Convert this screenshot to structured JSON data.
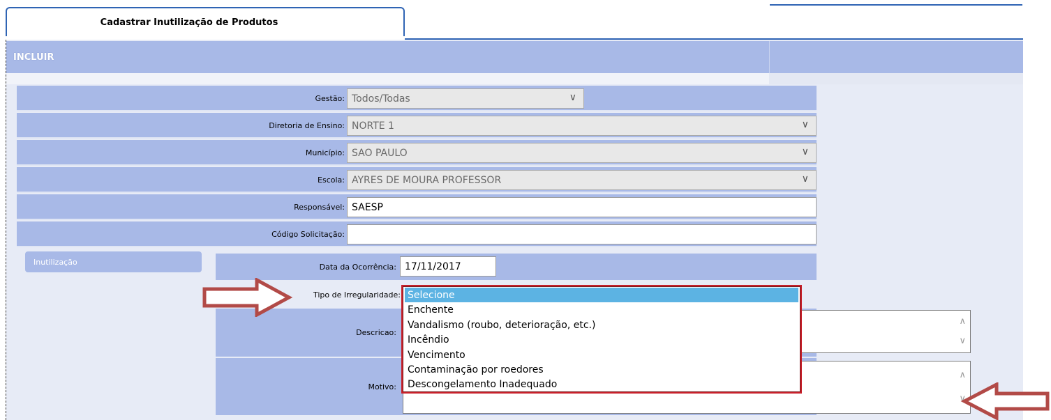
{
  "tab": {
    "title": "Cadastrar Inutilização de Produtos"
  },
  "panel": {
    "header": "INCLUIR"
  },
  "form": {
    "gestao": {
      "label": "Gestão:",
      "value": "Todos/Todas"
    },
    "diretoria": {
      "label": "Diretoria de Ensino:",
      "value": "NORTE 1"
    },
    "municipio": {
      "label": "Município:",
      "value": "SAO PAULO"
    },
    "escola": {
      "label": "Escola:",
      "value": "AYRES DE MOURA PROFESSOR"
    },
    "responsavel": {
      "label": "Responsável:",
      "value": "SAESP"
    },
    "codigo": {
      "label": "Código Solicitação:",
      "value": ""
    }
  },
  "inutilizacao": {
    "section_label": "Inutilização",
    "data_ocorrencia": {
      "label": "Data da Ocorrência:",
      "value": "17/11/2017"
    },
    "tipo_irregularidade": {
      "label": "Tipo de Irregularidade:",
      "options": [
        "Selecione",
        "Enchente",
        "Vandalismo (roubo, deterioração, etc.)",
        "Incêndio",
        "Vencimento",
        "Contaminação por roedores",
        "Descongelamento Inadequado"
      ],
      "selected_index": 0
    },
    "descricao": {
      "label": "Descricao:"
    },
    "motivo": {
      "label": "Motivo:"
    }
  },
  "colors": {
    "accent": "#2f64b4",
    "row_bg": "#a8b9e7",
    "highlight_border": "#c8202a",
    "selected_option": "#5cb3e3",
    "annotation_arrow": "#b24a47"
  },
  "icons": {
    "select_chevron": "chevron-down-icon",
    "scroll_up": "chevron-up-icon",
    "scroll_down": "chevron-down-icon",
    "annotation": "arrow-annotation-icon"
  }
}
